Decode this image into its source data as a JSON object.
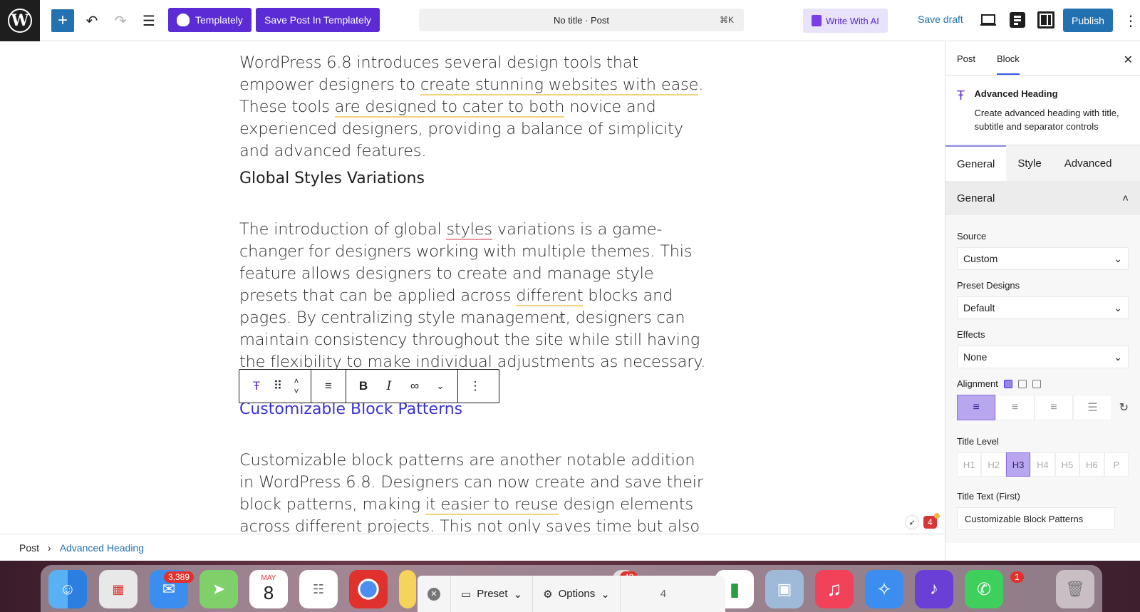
{
  "toolbar": {
    "templately_label": "Templately",
    "save_templately_label": "Save Post In Templately",
    "doc_title": "No title · Post",
    "shortcut": "⌘K",
    "write_ai_label": "Write With AI",
    "save_draft_label": "Save draft",
    "publish_label": "Publish"
  },
  "content": {
    "para1_a": "WordPress 6.8 introduces several design tools that empower designers to ",
    "para1_u1": "create stunning websites with ease",
    "para1_b": ". These tools ",
    "para1_u2": "are designed to cater to both",
    "para1_c": " novice and experienced designers, providing a balance of simplicity and advanced features.",
    "heading1": "Global Styles Variations",
    "para2_a": "The introduction of global ",
    "para2_u1": "styles",
    "para2_b": " variations is a game-changer for designers working with multiple themes. This feature allows designers to create and manage style presets that can be applied across ",
    "para2_u2": "different",
    "para2_c": " blocks and pages. By centralizing style management, designers can maintain consistency throughout the site while still having the flexibility to make individual adjustments as necessary.",
    "heading2": "Customizable Block Patterns",
    "para3_a": "Customizable block patterns are another notable addition in WordPress 6.8. Designers can now create and save their block patterns, making ",
    "para3_u1": "it easier to reuse",
    "para3_b": " design elements across different projects. This not only saves time but also allows for a"
  },
  "breadcrumb": {
    "root": "Post",
    "separator": "›",
    "current": "Advanced Heading"
  },
  "sidebar": {
    "tab_post": "Post",
    "tab_block": "Block",
    "block_title": "Advanced Heading",
    "block_desc": "Create advanced heading with title, subtitle and separator controls",
    "subtab_general": "General",
    "subtab_style": "Style",
    "subtab_advanced": "Advanced",
    "panel_title": "General",
    "source_label": "Source",
    "source_value": "Custom",
    "preset_label": "Preset Designs",
    "preset_value": "Default",
    "effects_label": "Effects",
    "effects_value": "None",
    "alignment_label": "Alignment",
    "title_level_label": "Title Level",
    "levels": [
      "H1",
      "H2",
      "H3",
      "H4",
      "H5",
      "H6",
      "P"
    ],
    "title_text_label": "Title Text (First)",
    "title_text_value": "Customizable Block Patterns",
    "notif_count": "4"
  },
  "dock": {
    "mail_badge": "3,389",
    "calendar_month": "MAY",
    "calendar_day": "8",
    "messages_badge": "43",
    "whatsapp_badge": "1",
    "popup_preset": "Preset",
    "popup_options": "Options",
    "popup_number": "4"
  },
  "colors": {
    "accent": "#2271b1",
    "templately": "#5b2bd6",
    "heading_active": "#3a33d4"
  }
}
